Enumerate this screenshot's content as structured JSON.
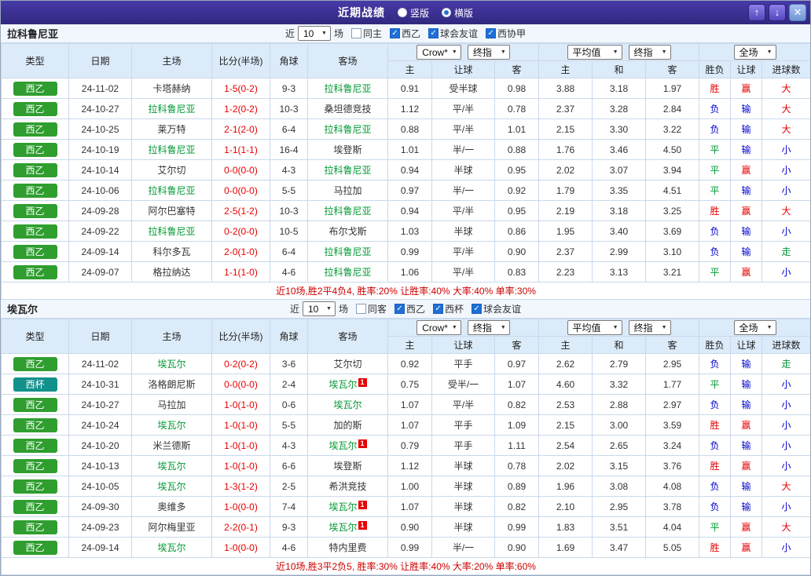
{
  "titlebar": {
    "title": "近期战绩",
    "radios": [
      {
        "label": "竖版",
        "selected": false
      },
      {
        "label": "横版",
        "selected": true
      }
    ],
    "buttons": {
      "up": "↑",
      "down": "↓",
      "close": "✕"
    }
  },
  "columns": {
    "type": "类型",
    "date": "日期",
    "home": "主场",
    "score": "比分(半场)",
    "corner": "角球",
    "away": "客场",
    "h": "主",
    "handicap": "让球",
    "a": "客",
    "d": "和",
    "result": "胜负",
    "goals": "进球数"
  },
  "selects": {
    "crow": "Crow*",
    "final": "终指",
    "average": "平均值",
    "full": "全场"
  },
  "colors": {
    "accent": "#31287f",
    "league_green": "#2f9e2f",
    "league_teal": "#12918c",
    "win_red": "#e60000",
    "lose_blue": "#0000cc",
    "draw_green": "#009933"
  },
  "sections": [
    {
      "team": "拉科鲁尼亚",
      "filter": {
        "prefix": "近",
        "count": "10",
        "suffix": "场",
        "checkboxes": [
          {
            "label": "同主",
            "checked": false
          },
          {
            "label": "西乙",
            "checked": true
          },
          {
            "label": "球会友谊",
            "checked": true
          },
          {
            "label": "西协甲",
            "checked": true
          }
        ]
      },
      "rows": [
        {
          "lg": "西乙",
          "lc": "green",
          "date": "24-11-02",
          "home": "卡塔赫纳",
          "hf": false,
          "score": "1-5(0-2)",
          "cn": "9-3",
          "away": "拉科鲁尼亚",
          "af": true,
          "o": [
            "0.91",
            "受半球",
            "0.98"
          ],
          "avg": [
            "3.88",
            "3.18",
            "1.97"
          ],
          "res": "胜",
          "resc": "r",
          "rq": "赢",
          "rqc": "r",
          "goal": "大",
          "goalc": "r"
        },
        {
          "lg": "西乙",
          "lc": "green",
          "date": "24-10-27",
          "home": "拉科鲁尼亚",
          "hf": true,
          "score": "1-2(0-2)",
          "cn": "10-3",
          "away": "桑坦德竞技",
          "af": false,
          "o": [
            "1.12",
            "平/半",
            "0.78"
          ],
          "avg": [
            "2.37",
            "3.28",
            "2.84"
          ],
          "res": "负",
          "resc": "b",
          "rq": "输",
          "rqc": "b",
          "goal": "大",
          "goalc": "r"
        },
        {
          "lg": "西乙",
          "lc": "green",
          "date": "24-10-25",
          "home": "莱万特",
          "hf": false,
          "score": "2-1(2-0)",
          "cn": "6-4",
          "away": "拉科鲁尼亚",
          "af": true,
          "o": [
            "0.88",
            "平/半",
            "1.01"
          ],
          "avg": [
            "2.15",
            "3.30",
            "3.22"
          ],
          "res": "负",
          "resc": "b",
          "rq": "输",
          "rqc": "b",
          "goal": "大",
          "goalc": "r"
        },
        {
          "lg": "西乙",
          "lc": "green",
          "date": "24-10-19",
          "home": "拉科鲁尼亚",
          "hf": true,
          "score": "1-1(1-1)",
          "cn": "16-4",
          "away": "埃登斯",
          "af": false,
          "o": [
            "1.01",
            "半/一",
            "0.88"
          ],
          "avg": [
            "1.76",
            "3.46",
            "4.50"
          ],
          "res": "平",
          "resc": "g",
          "rq": "输",
          "rqc": "b",
          "goal": "小",
          "goalc": "b"
        },
        {
          "lg": "西乙",
          "lc": "green",
          "date": "24-10-14",
          "home": "艾尔切",
          "hf": false,
          "score": "0-0(0-0)",
          "cn": "4-3",
          "away": "拉科鲁尼亚",
          "af": true,
          "o": [
            "0.94",
            "半球",
            "0.95"
          ],
          "avg": [
            "2.02",
            "3.07",
            "3.94"
          ],
          "res": "平",
          "resc": "g",
          "rq": "赢",
          "rqc": "r",
          "goal": "小",
          "goalc": "b"
        },
        {
          "lg": "西乙",
          "lc": "green",
          "date": "24-10-06",
          "home": "拉科鲁尼亚",
          "hf": true,
          "score": "0-0(0-0)",
          "cn": "5-5",
          "away": "马拉加",
          "af": false,
          "o": [
            "0.97",
            "半/一",
            "0.92"
          ],
          "avg": [
            "1.79",
            "3.35",
            "4.51"
          ],
          "res": "平",
          "resc": "g",
          "rq": "输",
          "rqc": "b",
          "goal": "小",
          "goalc": "b"
        },
        {
          "lg": "西乙",
          "lc": "green",
          "date": "24-09-28",
          "home": "阿尔巴塞特",
          "hf": false,
          "score": "2-5(1-2)",
          "cn": "10-3",
          "away": "拉科鲁尼亚",
          "af": true,
          "o": [
            "0.94",
            "平/半",
            "0.95"
          ],
          "avg": [
            "2.19",
            "3.18",
            "3.25"
          ],
          "res": "胜",
          "resc": "r",
          "rq": "赢",
          "rqc": "r",
          "goal": "大",
          "goalc": "r"
        },
        {
          "lg": "西乙",
          "lc": "green",
          "date": "24-09-22",
          "home": "拉科鲁尼亚",
          "hf": true,
          "score": "0-2(0-0)",
          "cn": "10-5",
          "away": "布尔戈斯",
          "af": false,
          "o": [
            "1.03",
            "半球",
            "0.86"
          ],
          "avg": [
            "1.95",
            "3.40",
            "3.69"
          ],
          "res": "负",
          "resc": "b",
          "rq": "输",
          "rqc": "b",
          "goal": "小",
          "goalc": "b"
        },
        {
          "lg": "西乙",
          "lc": "green",
          "date": "24-09-14",
          "home": "科尔多瓦",
          "hf": false,
          "score": "2-0(1-0)",
          "cn": "6-4",
          "away": "拉科鲁尼亚",
          "af": true,
          "o": [
            "0.99",
            "平/半",
            "0.90"
          ],
          "avg": [
            "2.37",
            "2.99",
            "3.10"
          ],
          "res": "负",
          "resc": "b",
          "rq": "输",
          "rqc": "b",
          "goal": "走",
          "goalc": "g"
        },
        {
          "lg": "西乙",
          "lc": "green",
          "date": "24-09-07",
          "home": "格拉纳达",
          "hf": false,
          "score": "1-1(1-0)",
          "cn": "4-6",
          "away": "拉科鲁尼亚",
          "af": true,
          "o": [
            "1.06",
            "平/半",
            "0.83"
          ],
          "avg": [
            "2.23",
            "3.13",
            "3.21"
          ],
          "res": "平",
          "resc": "g",
          "rq": "赢",
          "rqc": "r",
          "goal": "小",
          "goalc": "b"
        }
      ],
      "summary": "近10场,胜2平4负4, 胜率:20% 让胜率:40% 大率:40% 单率:30%"
    },
    {
      "team": "埃瓦尔",
      "filter": {
        "prefix": "近",
        "count": "10",
        "suffix": "场",
        "checkboxes": [
          {
            "label": "同客",
            "checked": false
          },
          {
            "label": "西乙",
            "checked": true
          },
          {
            "label": "西杯",
            "checked": true
          },
          {
            "label": "球会友谊",
            "checked": true
          }
        ]
      },
      "rows": [
        {
          "lg": "西乙",
          "lc": "green",
          "date": "24-11-02",
          "home": "埃瓦尔",
          "hf": true,
          "score": "0-2(0-2)",
          "cn": "3-6",
          "away": "艾尔切",
          "af": false,
          "o": [
            "0.92",
            "平手",
            "0.97"
          ],
          "avg": [
            "2.62",
            "2.79",
            "2.95"
          ],
          "res": "负",
          "resc": "b",
          "rq": "输",
          "rqc": "b",
          "goal": "走",
          "goalc": "g"
        },
        {
          "lg": "西杯",
          "lc": "teal",
          "date": "24-10-31",
          "home": "洛格朗尼斯",
          "hf": false,
          "score": "0-0(0-0)",
          "cn": "2-4",
          "away": "埃瓦尔",
          "af": true,
          "arc": "1",
          "o": [
            "0.75",
            "受半/一",
            "1.07"
          ],
          "avg": [
            "4.60",
            "3.32",
            "1.77"
          ],
          "res": "平",
          "resc": "g",
          "rq": "输",
          "rqc": "b",
          "goal": "小",
          "goalc": "b"
        },
        {
          "lg": "西乙",
          "lc": "green",
          "date": "24-10-27",
          "home": "马拉加",
          "hf": false,
          "score": "1-0(1-0)",
          "cn": "0-6",
          "away": "埃瓦尔",
          "af": true,
          "o": [
            "1.07",
            "平/半",
            "0.82"
          ],
          "avg": [
            "2.53",
            "2.88",
            "2.97"
          ],
          "res": "负",
          "resc": "b",
          "rq": "输",
          "rqc": "b",
          "goal": "小",
          "goalc": "b"
        },
        {
          "lg": "西乙",
          "lc": "green",
          "date": "24-10-24",
          "home": "埃瓦尔",
          "hf": true,
          "score": "1-0(1-0)",
          "cn": "5-5",
          "away": "加的斯",
          "af": false,
          "o": [
            "1.07",
            "平手",
            "1.09"
          ],
          "avg": [
            "2.15",
            "3.00",
            "3.59"
          ],
          "res": "胜",
          "resc": "r",
          "rq": "赢",
          "rqc": "r",
          "goal": "小",
          "goalc": "b"
        },
        {
          "lg": "西乙",
          "lc": "green",
          "date": "24-10-20",
          "home": "米兰德斯",
          "hf": false,
          "score": "1-0(1-0)",
          "cn": "4-3",
          "away": "埃瓦尔",
          "af": true,
          "arc": "1",
          "o": [
            "0.79",
            "平手",
            "1.11"
          ],
          "avg": [
            "2.54",
            "2.65",
            "3.24"
          ],
          "res": "负",
          "resc": "b",
          "rq": "输",
          "rqc": "b",
          "goal": "小",
          "goalc": "b"
        },
        {
          "lg": "西乙",
          "lc": "green",
          "date": "24-10-13",
          "home": "埃瓦尔",
          "hf": true,
          "score": "1-0(1-0)",
          "cn": "6-6",
          "away": "埃登斯",
          "af": false,
          "o": [
            "1.12",
            "半球",
            "0.78"
          ],
          "avg": [
            "2.02",
            "3.15",
            "3.76"
          ],
          "res": "胜",
          "resc": "r",
          "rq": "赢",
          "rqc": "r",
          "goal": "小",
          "goalc": "b"
        },
        {
          "lg": "西乙",
          "lc": "green",
          "date": "24-10-05",
          "home": "埃瓦尔",
          "hf": true,
          "score": "1-3(1-2)",
          "cn": "2-5",
          "away": "希洪竞技",
          "af": false,
          "o": [
            "1.00",
            "半球",
            "0.89"
          ],
          "avg": [
            "1.96",
            "3.08",
            "4.08"
          ],
          "res": "负",
          "resc": "b",
          "rq": "输",
          "rqc": "b",
          "goal": "大",
          "goalc": "r"
        },
        {
          "lg": "西乙",
          "lc": "green",
          "date": "24-09-30",
          "home": "奥维多",
          "hf": false,
          "score": "1-0(0-0)",
          "cn": "7-4",
          "away": "埃瓦尔",
          "af": true,
          "arc": "1",
          "o": [
            "1.07",
            "半球",
            "0.82"
          ],
          "avg": [
            "2.10",
            "2.95",
            "3.78"
          ],
          "res": "负",
          "resc": "b",
          "rq": "输",
          "rqc": "b",
          "goal": "小",
          "goalc": "b"
        },
        {
          "lg": "西乙",
          "lc": "green",
          "date": "24-09-23",
          "home": "阿尔梅里亚",
          "hf": false,
          "score": "2-2(0-1)",
          "cn": "9-3",
          "away": "埃瓦尔",
          "af": true,
          "arc": "1",
          "o": [
            "0.90",
            "半球",
            "0.99"
          ],
          "avg": [
            "1.83",
            "3.51",
            "4.04"
          ],
          "res": "平",
          "resc": "g",
          "rq": "赢",
          "rqc": "r",
          "goal": "大",
          "goalc": "r"
        },
        {
          "lg": "西乙",
          "lc": "green",
          "date": "24-09-14",
          "home": "埃瓦尔",
          "hf": true,
          "score": "1-0(0-0)",
          "cn": "4-6",
          "away": "特内里费",
          "af": false,
          "o": [
            "0.99",
            "半/一",
            "0.90"
          ],
          "avg": [
            "1.69",
            "3.47",
            "5.05"
          ],
          "res": "胜",
          "resc": "r",
          "rq": "赢",
          "rqc": "r",
          "goal": "小",
          "goalc": "b"
        }
      ],
      "summary": "近10场,胜3平2负5, 胜率:30% 让胜率:40% 大率:20% 单率:60%"
    }
  ]
}
